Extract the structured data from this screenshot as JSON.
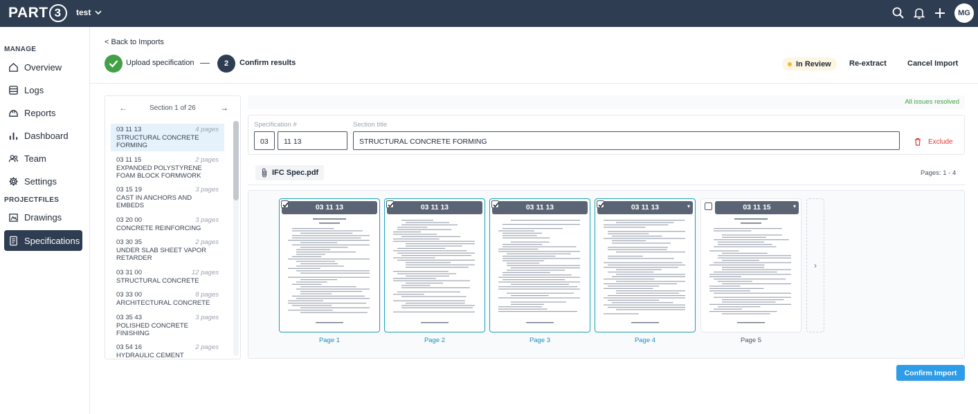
{
  "topbar": {
    "logo_text": "PART",
    "logo_digit": "3",
    "project_name": "test",
    "avatar_initials": "MG",
    "icons": [
      "search-icon",
      "bell-icon",
      "plus-icon"
    ]
  },
  "sidebar": {
    "manage_header": "MANAGE",
    "projectfiles_header": "PROJECTFILES",
    "items": [
      {
        "label": "Overview",
        "icon": "home-icon"
      },
      {
        "label": "Logs",
        "icon": "logs-icon"
      },
      {
        "label": "Reports",
        "icon": "reports-icon"
      },
      {
        "label": "Dashboard",
        "icon": "dashboard-icon"
      },
      {
        "label": "Team",
        "icon": "team-icon"
      },
      {
        "label": "Settings",
        "icon": "gear-icon"
      },
      {
        "label": "Drawings",
        "icon": "drawings-icon"
      },
      {
        "label": "Specifications",
        "icon": "specifications-icon",
        "active": true
      }
    ]
  },
  "header": {
    "back_link": "< Back to Imports",
    "step1_label": "Upload specification",
    "step2_number": "2",
    "step2_label": "Confirm results",
    "status": "In Review",
    "reextract": "Re-extract",
    "cancel": "Cancel Import"
  },
  "sections": {
    "nav_prev": "←",
    "nav_label": "Section 1 of 26",
    "nav_next": "→",
    "items": [
      {
        "number": "03 11 13",
        "title": "STRUCTURAL CONCRETE FORMING",
        "pages": "4 pages"
      },
      {
        "number": "03 11 15",
        "title": "EXPANDED POLYSTYRENE FOAM BLOCK FORMWORK",
        "pages": "2 pages"
      },
      {
        "number": "03 15 19",
        "title": "CAST IN ANCHORS AND EMBEDS",
        "pages": "3 pages"
      },
      {
        "number": "03 20 00",
        "title": "CONCRETE REINFORCING",
        "pages": "3 pages"
      },
      {
        "number": "03 30 35",
        "title": "UNDER SLAB SHEET VAPOR RETARDER",
        "pages": "2 pages"
      },
      {
        "number": "03 31 00",
        "title": "STRUCTURAL CONCRETE",
        "pages": "12 pages"
      },
      {
        "number": "03 33 00",
        "title": "ARCHITECTURAL CONCRETE",
        "pages": "8 pages"
      },
      {
        "number": "03 35 43",
        "title": "POLISHED CONCRETE FINISHING",
        "pages": "3 pages"
      },
      {
        "number": "03 54 16",
        "title": "HYDRAULIC CEMENT",
        "pages": "2 pages"
      }
    ]
  },
  "detail": {
    "resolved": "All issues resolved",
    "spec_label": "Specification #",
    "spec_division": "03",
    "spec_number": "11 13",
    "title_label": "Section title",
    "title_value": "STRUCTURAL CONCRETE FORMING",
    "exclude": "Exclude",
    "file_name": "IFC Spec.pdf",
    "pages_range": "Pages: 1 - 4",
    "pages": [
      {
        "header": "03 11 13",
        "label": "Page 1",
        "checked": true
      },
      {
        "header": "03 11 13",
        "label": "Page 2",
        "checked": true
      },
      {
        "header": "03 11 13",
        "label": "Page 3",
        "checked": true
      },
      {
        "header": "03 11 13",
        "label": "Page 4",
        "checked": true
      },
      {
        "header": "03 11 15",
        "label": "Page 5",
        "checked": false
      }
    ],
    "next_arrow": "›"
  },
  "footer": {
    "confirm": "Confirm Import"
  },
  "colors": {
    "topbar": "#2e3d52",
    "accent": "#2e9ce6",
    "success": "#43a047",
    "danger": "#e53935"
  }
}
